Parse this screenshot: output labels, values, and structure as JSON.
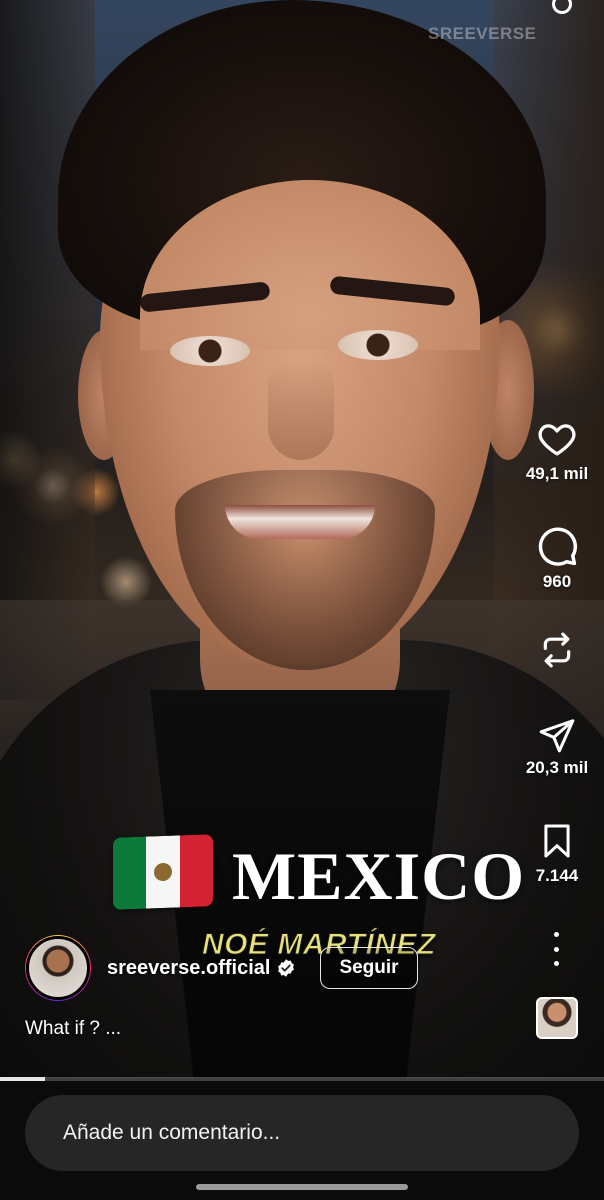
{
  "video": {
    "watermark": "SREEVERSE",
    "overlay_country": "MEXICO",
    "overlay_name": "NOÉ MARTÍNEZ",
    "progress": 0.074
  },
  "actions": {
    "likes": "49,1 mil",
    "comments": "960",
    "shares": "20,3 mil",
    "saves": "7.144"
  },
  "user": {
    "username": "sreeverse.official",
    "follow_label": "Seguir",
    "caption": "What if ? ..."
  },
  "comment_input": {
    "placeholder": "Añade un comentario..."
  },
  "colors": {
    "mexico_green": "#0e7a3a",
    "mexico_red": "#d32232",
    "caption_yellow": "#e8e07a",
    "comment_bg": "#262626"
  },
  "icons": {
    "like": "heart-icon",
    "comment": "speech-bubble-icon",
    "repost": "repost-icon",
    "share": "paper-plane-icon",
    "save": "bookmark-icon",
    "more": "more-vertical-icon"
  }
}
